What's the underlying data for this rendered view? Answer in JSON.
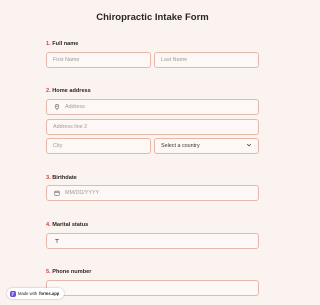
{
  "form": {
    "title": "Chiropractic Intake Form"
  },
  "questions": {
    "q1": {
      "num": "1.",
      "label": "Full name"
    },
    "q2": {
      "num": "2.",
      "label": "Home address"
    },
    "q3": {
      "num": "3.",
      "label": "Birthdate"
    },
    "q4": {
      "num": "4.",
      "label": "Marital status"
    },
    "q5": {
      "num": "5.",
      "label": "Phone number"
    }
  },
  "fields": {
    "first_name": {
      "placeholder": "First Name"
    },
    "last_name": {
      "placeholder": "Last Name"
    },
    "address": {
      "placeholder": "Address",
      "icon": "location-pin-icon"
    },
    "address_line2": {
      "placeholder": "Address line 2"
    },
    "city": {
      "placeholder": "City"
    },
    "country": {
      "selected": "Select a country",
      "icon": "chevron-down-icon"
    },
    "birthdate": {
      "placeholder": "MM/DD/YYYY",
      "icon": "calendar-icon"
    },
    "marital_status": {
      "value": "",
      "icon": "text-icon"
    },
    "phone": {
      "value": ""
    }
  },
  "badge": {
    "prefix": "Made with",
    "brand": "forms.app"
  },
  "colors": {
    "background": "#fbf3ef",
    "field_border": "#e4b9ab",
    "question_number": "#d9413a",
    "brand": "#6b4fd8"
  }
}
